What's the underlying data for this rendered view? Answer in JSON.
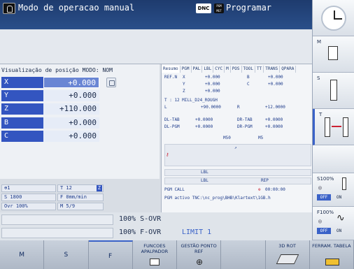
{
  "header": {
    "title": "Modo de operacao manual",
    "dnc_badge": "DNC",
    "pgm_badge": "PGM MGT",
    "program_mode": "Programar"
  },
  "position": {
    "header": "Visualização de posição MODO: NOM",
    "axes": [
      {
        "name": "X",
        "value": "+0.000"
      },
      {
        "name": "Y",
        "value": "+0.000"
      },
      {
        "name": "Z",
        "value": "+110.000"
      },
      {
        "name": "B",
        "value": "+0.000"
      },
      {
        "name": "C",
        "value": "+0.000"
      }
    ]
  },
  "status_small": {
    "axis_icon": "⊕1",
    "tool": "T 12",
    "tool_flag": "Z",
    "spindle": "S 1800",
    "feed": "F 0mm/min",
    "override": "Ovr 100%",
    "mfunc": "M 5/9"
  },
  "status": {
    "tabs": [
      "Resumo",
      "PGM",
      "PAL",
      "LBL",
      "CYC",
      "M",
      "POS",
      "TOOL",
      "TT",
      "TRANS",
      "QPARA"
    ],
    "ref_label": "REF.N",
    "pos_x_label": "X",
    "pos_x": "+0.000",
    "pos_y_label": "Y",
    "pos_y": "+0.000",
    "pos_z_label": "Z",
    "pos_z": "+0.000",
    "pos_b_label": "B",
    "pos_b": "+0.000",
    "pos_c_label": "C",
    "pos_c": "+0.000",
    "tool_line": "T : 12    MILL_D24_ROUGH",
    "l_label": "L",
    "l_value": "+90.0000",
    "r_label": "R",
    "r_value": "+12.0000",
    "dl_tab_label": "DL-TAB",
    "dl_tab": "+0.0000",
    "dr_tab_label": "DR-TAB",
    "dr_tab": "+0.0000",
    "dl_pgm_label": "DL-PGM",
    "dl_pgm": "+0.0000",
    "dr_pgm_label": "DR-PGM",
    "dr_pgm": "+0.0000",
    "m50": "M50",
    "m5": "M5",
    "lbl1": "LBL",
    "lbl2": "LBL",
    "rep": "REP",
    "pgm_call": "PGM CALL",
    "time": "00:00:00",
    "pgm_active": "PGM activo TNC:\\nc_prog\\BHB\\Klartext\\1GB.h"
  },
  "overrides": {
    "s_ovr": "100% S-OVR",
    "f_ovr": "100% F-OVR",
    "limit": "LIMIT 1"
  },
  "softkeys": [
    {
      "label": "M"
    },
    {
      "label": "S"
    },
    {
      "label": "F"
    },
    {
      "label": "FUNCOES APALPADOR"
    },
    {
      "label": "GESTÃO PONTO REF"
    },
    {
      "label": ""
    },
    {
      "label": "3D ROT"
    },
    {
      "label": "FERRAM. TABELA"
    }
  ],
  "rail": {
    "m_label": "M",
    "s_label": "S",
    "t_label": "T",
    "s_ovr_label": "S100%",
    "off1": "OFF",
    "on1": "ON",
    "f_ovr_label": "F100%",
    "off2": "OFF",
    "on2": "ON"
  },
  "colors": {
    "header_bg": "#1e3b6e",
    "axis_blue": "#3355c0",
    "accent": "#3a62c8",
    "softkey_bg": "#c9d1dc"
  }
}
